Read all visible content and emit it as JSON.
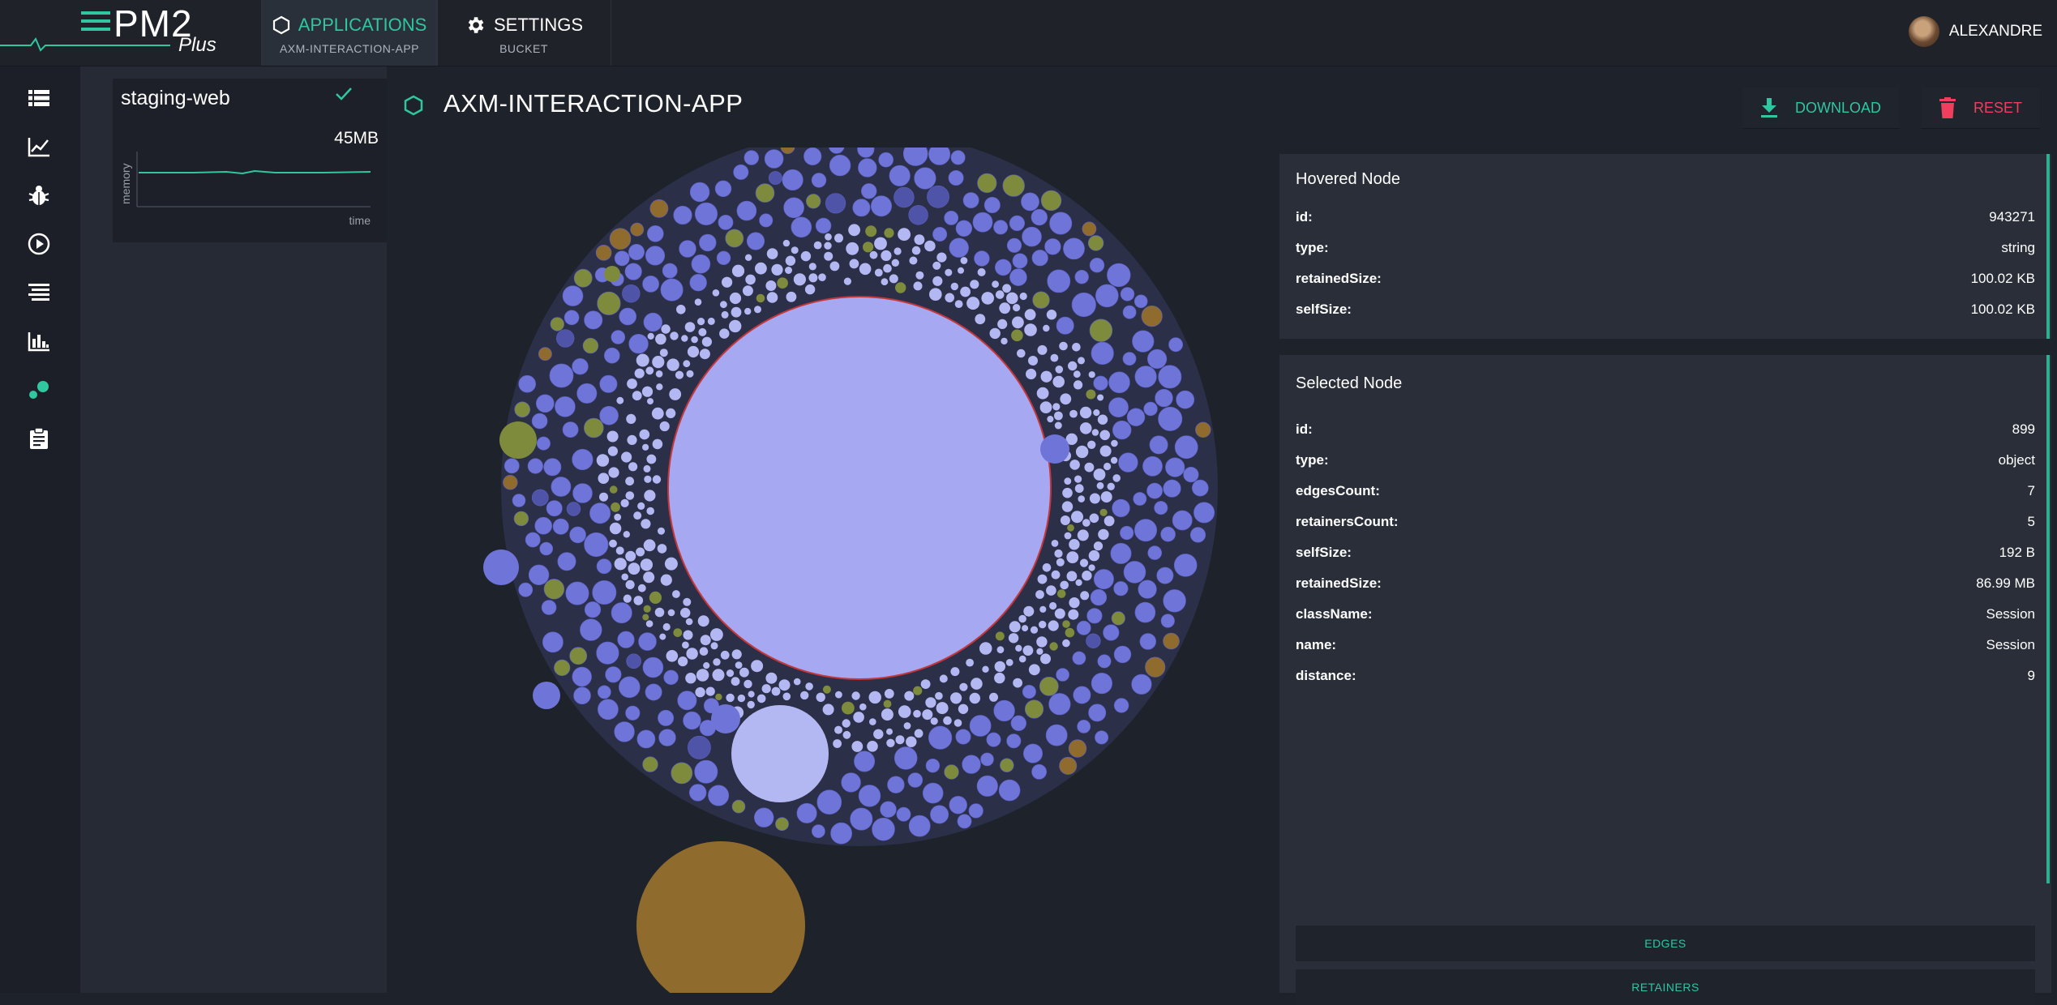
{
  "brand": {
    "name": "PM2",
    "suffix": "Plus"
  },
  "nav": {
    "applications": {
      "label": "APPLICATIONS",
      "sub": "AXM-INTERACTION-APP"
    },
    "settings": {
      "label": "SETTINGS",
      "sub": "BUCKET"
    }
  },
  "user": {
    "name": "ALEXANDRE"
  },
  "rail_icons": [
    "list-icon",
    "chart-line-icon",
    "bug-icon",
    "play-circle-icon",
    "logs-icon",
    "bar-chart-icon",
    "memory-graph-icon",
    "clipboard-icon"
  ],
  "process": {
    "name": "staging-web",
    "memory": "45MB",
    "y_axis": "memory",
    "x_axis": "time",
    "status": "online"
  },
  "app": {
    "title": "AXM-INTERACTION-APP"
  },
  "actions": {
    "download": "DOWNLOAD",
    "reset": "RESET"
  },
  "hovered": {
    "title": "Hovered Node",
    "rows": [
      {
        "k": "id:",
        "v": "943271"
      },
      {
        "k": "type:",
        "v": "string"
      },
      {
        "k": "retainedSize:",
        "v": "100.02 KB"
      },
      {
        "k": "selfSize:",
        "v": "100.02 KB"
      }
    ]
  },
  "selected": {
    "title": "Selected Node",
    "rows": [
      {
        "k": "id:",
        "v": "899"
      },
      {
        "k": "type:",
        "v": "object"
      },
      {
        "k": "edgesCount:",
        "v": "7"
      },
      {
        "k": "retainersCount:",
        "v": "5"
      },
      {
        "k": "selfSize:",
        "v": "192 B"
      },
      {
        "k": "retainedSize:",
        "v": "86.99 MB"
      },
      {
        "k": "className:",
        "v": "Session"
      },
      {
        "k": "name:",
        "v": "Session"
      },
      {
        "k": "distance:",
        "v": "9"
      }
    ]
  },
  "panel_buttons": {
    "edges": "EDGES",
    "retainers": "RETAINERS"
  },
  "colors": {
    "accent": "#2fc6a0",
    "danger": "#f03e5e",
    "node_blue": "#6f74d8",
    "node_light": "#b4b8f2",
    "node_olive": "#7e8b3c",
    "node_brown": "#8f6b2e"
  }
}
